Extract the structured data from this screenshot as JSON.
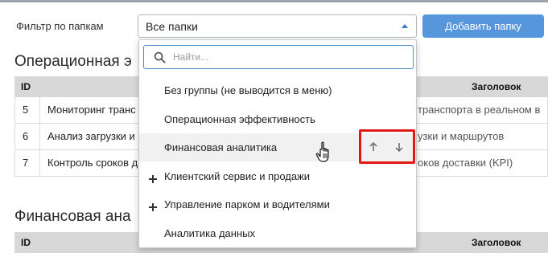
{
  "filter": {
    "label": "Фильтр по папкам",
    "selected": "Все папки",
    "add_button": "Добавить папку"
  },
  "sections": [
    {
      "title": "Операционная э",
      "columns": {
        "id": "ID",
        "title": "Заголовок"
      },
      "rows": [
        {
          "id": "5",
          "name": "Мониторинг транс",
          "desc": "транспорта в реальном в"
        },
        {
          "id": "6",
          "name": "Анализ загрузки и",
          "desc": "узки и маршрутов"
        },
        {
          "id": "7",
          "name": "Контроль сроков д",
          "desc": "оков доставки (KPI)"
        }
      ]
    },
    {
      "title": "Финансовая ана",
      "columns": {
        "id": "ID",
        "title": "Заголовок"
      }
    }
  ],
  "dropdown": {
    "search_placeholder": "Найти...",
    "search_value": "",
    "items": [
      {
        "label": "Без группы (не выводится в меню)",
        "expandable": false
      },
      {
        "label": "Операционная эффективность",
        "expandable": false
      },
      {
        "label": "Финансовая аналитика",
        "expandable": false,
        "hovered": true
      },
      {
        "label": "Клиентский сервис и продажи",
        "expandable": true
      },
      {
        "label": "Управление парком и водителями",
        "expandable": true
      },
      {
        "label": "Аналитика данных",
        "expandable": false
      }
    ]
  },
  "icons": {
    "search": "search-icon",
    "caret": "caret-up-icon",
    "move_up": "arrow-up-icon",
    "move_down": "arrow-down-icon",
    "expand": "plus-icon",
    "cursor": "hand-pointer-icon"
  },
  "colors": {
    "primary_button": "#5696db",
    "focus_border": "#4a8fd6",
    "highlight": "#e01818",
    "table_header": "#d8d8d8",
    "caret": "#3b78c4"
  }
}
